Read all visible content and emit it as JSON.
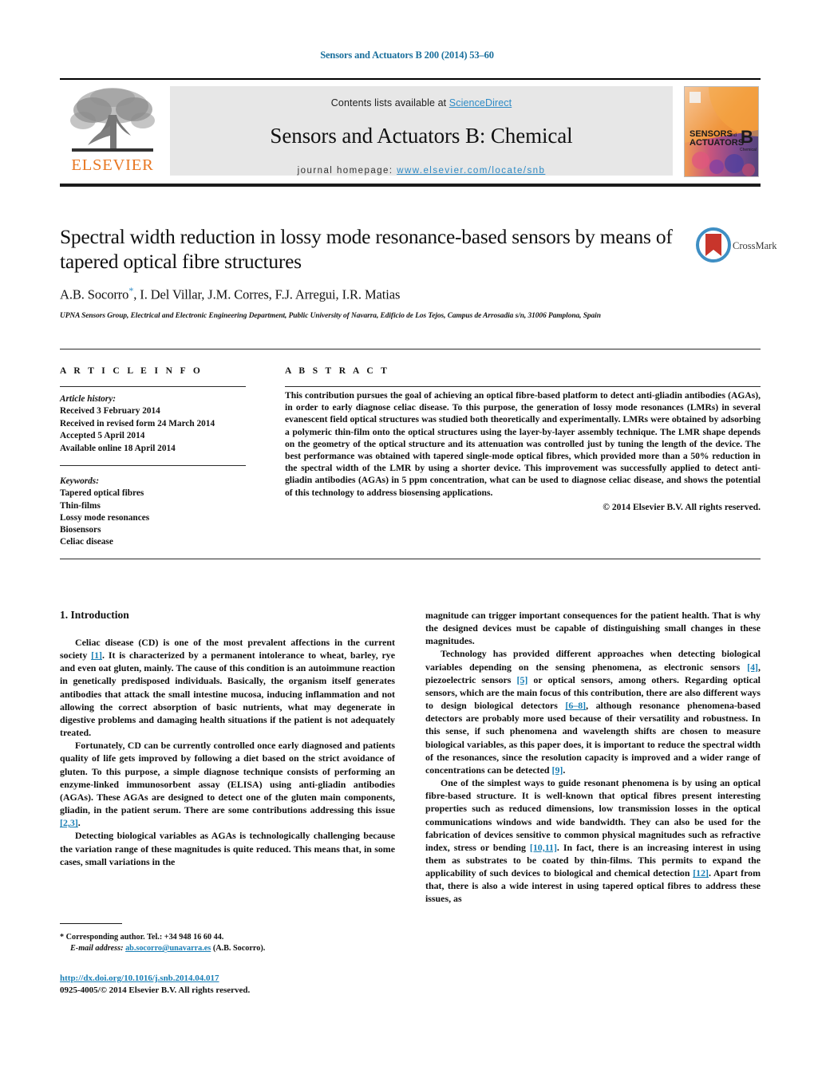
{
  "running_head": "Sensors and Actuators B 200 (2014) 53–60",
  "masthead": {
    "contents_prefix": "Contents lists available at ",
    "sciencedirect": "ScienceDirect",
    "journal_title": "Sensors and Actuators B: Chemical",
    "homepage_prefix": "journal homepage: ",
    "homepage_url": "www.elsevier.com/locate/snb",
    "publisher_wordmark": "ELSEVIER",
    "cover": {
      "line1": "SENSORS",
      "line1_suffix": "and",
      "line2": "ACTUATORS",
      "letter": "B",
      "sub": "Chemical"
    },
    "accent_link_color": "#2e8bc6",
    "publisher_color": "#E87722"
  },
  "article": {
    "title": "Spectral width reduction in lossy mode resonance-based sensors by means of tapered optical fibre structures",
    "authors": "A.B. Socorro",
    "authors_rest": ", I. Del Villar, J.M. Corres, F.J. Arregui, I.R. Matias",
    "corresponding_marker": "*",
    "affiliation": "UPNA Sensors Group, Electrical and Electronic Engineering Department, Public University of Navarra, Edificio de Los Tejos, Campus de Arrosadia s/n, 31006 Pamplona, Spain",
    "crossmark_label": "CrossMark"
  },
  "article_info": {
    "heading": "A R T I C L E  I N F O",
    "history_label": "Article history:",
    "history": [
      "Received 3 February 2014",
      "Received in revised form 24 March 2014",
      "Accepted 5 April 2014",
      "Available online 18 April 2014"
    ],
    "keywords_label": "Keywords:",
    "keywords": [
      "Tapered optical fibres",
      "Thin-films",
      "Lossy mode resonances",
      "Biosensors",
      "Celiac disease"
    ]
  },
  "abstract": {
    "heading": "A B S T R A C T",
    "text": "This contribution pursues the goal of achieving an optical fibre-based platform to detect anti-gliadin antibodies (AGAs), in order to early diagnose celiac disease. To this purpose, the generation of lossy mode resonances (LMRs) in several evanescent field optical structures was studied both theoretically and experimentally. LMRs were obtained by adsorbing a polymeric thin-film onto the optical structures using the layer-by-layer assembly technique. The LMR shape depends on the geometry of the optical structure and its attenuation was controlled just by tuning the length of the device. The best performance was obtained with tapered single-mode optical fibres, which provided more than a 50% reduction in the spectral width of the LMR by using a shorter device. This improvement was successfully applied to detect anti-gliadin antibodies (AGAs) in 5 ppm concentration, what can be used to diagnose celiac disease, and shows the potential of this technology to address biosensing applications.",
    "copyright": "© 2014 Elsevier B.V. All rights reserved."
  },
  "body": {
    "section_heading": "1.  Introduction",
    "left_paragraphs": [
      {
        "parts": [
          {
            "t": "Celiac disease (CD) is one of the most prevalent affections in the current society "
          },
          {
            "t": "[1]",
            "ref": true
          },
          {
            "t": ". It is characterized by a permanent intolerance to wheat, barley, rye and even oat gluten, mainly. The cause of this condition is an autoimmune reaction in genetically predisposed individuals. Basically, the organism itself generates antibodies that attack the small intestine mucosa, inducing inflammation and not allowing the correct absorption of basic nutrients, what may degenerate in digestive problems and damaging health situations if the patient is not adequately treated."
          }
        ]
      },
      {
        "parts": [
          {
            "t": "Fortunately, CD can be currently controlled once early diagnosed and patients quality of life gets improved by following a diet based on the strict avoidance of gluten. To this purpose, a simple diagnose technique consists of performing an enzyme-linked immunosorbent assay (ELISA) using anti-gliadin antibodies (AGAs). These AGAs are designed to detect one of the gluten main components, gliadin, in the patient serum. There are some contributions addressing this issue "
          },
          {
            "t": "[2,3]",
            "ref": true
          },
          {
            "t": "."
          }
        ]
      },
      {
        "parts": [
          {
            "t": "Detecting biological variables as AGAs is technologically challenging because the variation range of these magnitudes is quite reduced. This means that, in some cases, small variations in the"
          }
        ]
      }
    ],
    "right_paragraphs": [
      {
        "indent": false,
        "parts": [
          {
            "t": "magnitude can trigger important consequences for the patient health. That is why the designed devices must be capable of distinguishing small changes in these magnitudes."
          }
        ]
      },
      {
        "indent": true,
        "parts": [
          {
            "t": "Technology has provided different approaches when detecting biological variables depending on the sensing phenomena, as electronic sensors "
          },
          {
            "t": "[4]",
            "ref": true
          },
          {
            "t": ", piezoelectric sensors "
          },
          {
            "t": "[5]",
            "ref": true
          },
          {
            "t": " or optical sensors, among others. Regarding optical sensors, which are the main focus of this contribution, there are also different ways to design biological detectors "
          },
          {
            "t": "[6–8]",
            "ref": true
          },
          {
            "t": ", although resonance phenomena-based detectors are probably more used because of their versatility and robustness. In this sense, if such phenomena and wavelength shifts are chosen to measure biological variables, as this paper does, it is important to reduce the spectral width of the resonances, since the resolution capacity is improved and a wider range of concentrations can be detected "
          },
          {
            "t": "[9]",
            "ref": true
          },
          {
            "t": "."
          }
        ]
      },
      {
        "indent": true,
        "parts": [
          {
            "t": "One of the simplest ways to guide resonant phenomena is by using an optical fibre-based structure. It is well-known that optical fibres present interesting properties such as reduced dimensions, low transmission losses in the optical communications windows and wide bandwidth. They can also be used for the fabrication of devices sensitive to common physical magnitudes such as refractive index, stress or bending "
          },
          {
            "t": "[10,11]",
            "ref": true
          },
          {
            "t": ". In fact, there is an increasing interest in using them as substrates to be coated by thin-films. This permits to expand the applicability of such devices to biological and chemical detection "
          },
          {
            "t": "[12]",
            "ref": true
          },
          {
            "t": ". Apart from that, there is also a wide interest in using tapered optical fibres to address these issues, as"
          }
        ]
      }
    ]
  },
  "footnote": {
    "marker": "*",
    "corresponding": "Corresponding author. Tel.: +34 948 16 60 44.",
    "email_label": "E-mail address:",
    "email": "ab.socorro@unavarra.es",
    "email_owner": "(A.B. Socorro)."
  },
  "footer": {
    "doi": "http://dx.doi.org/10.1016/j.snb.2014.04.017",
    "issn_line": "0925-4005/© 2014 Elsevier B.V. All rights reserved."
  }
}
